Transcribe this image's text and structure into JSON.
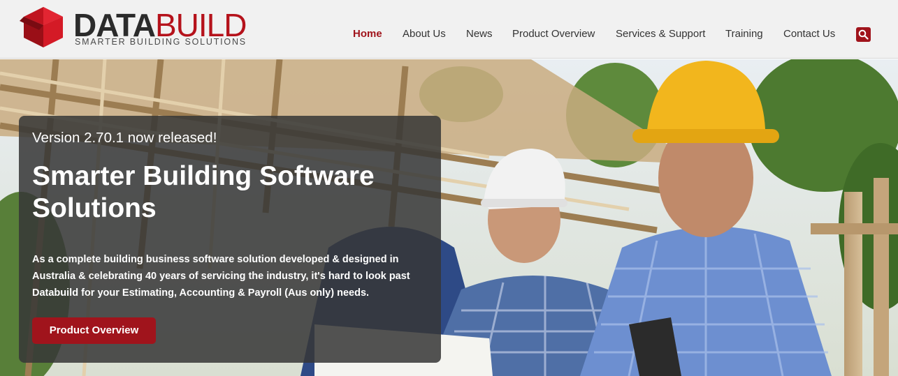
{
  "brand": {
    "word_dark": "DATA",
    "word_accent": "BUILD",
    "tagline": "SMARTER BUILDING SOLUTIONS",
    "accent_color": "#b5121b"
  },
  "nav": {
    "items": [
      {
        "label": "Home",
        "active": true
      },
      {
        "label": "About Us",
        "active": false
      },
      {
        "label": "News",
        "active": false
      },
      {
        "label": "Product Overview",
        "active": false
      },
      {
        "label": "Services & Support",
        "active": false
      },
      {
        "label": "Training",
        "active": false
      },
      {
        "label": "Contact Us",
        "active": false
      }
    ],
    "search_icon": "search-icon"
  },
  "hero": {
    "kicker": "Version 2.70.1 now released!",
    "title": "Smarter Building Software Solutions",
    "body": "As a complete building business software solution developed & designed in Australia & celebrating 40 years of servicing the industry, it's hard to look past Databuild for your Estimating, Accounting & Payroll (Aus only) needs.",
    "cta_label": "Product Overview",
    "background": "photo of construction workers in hard hats under timber roof frame"
  }
}
